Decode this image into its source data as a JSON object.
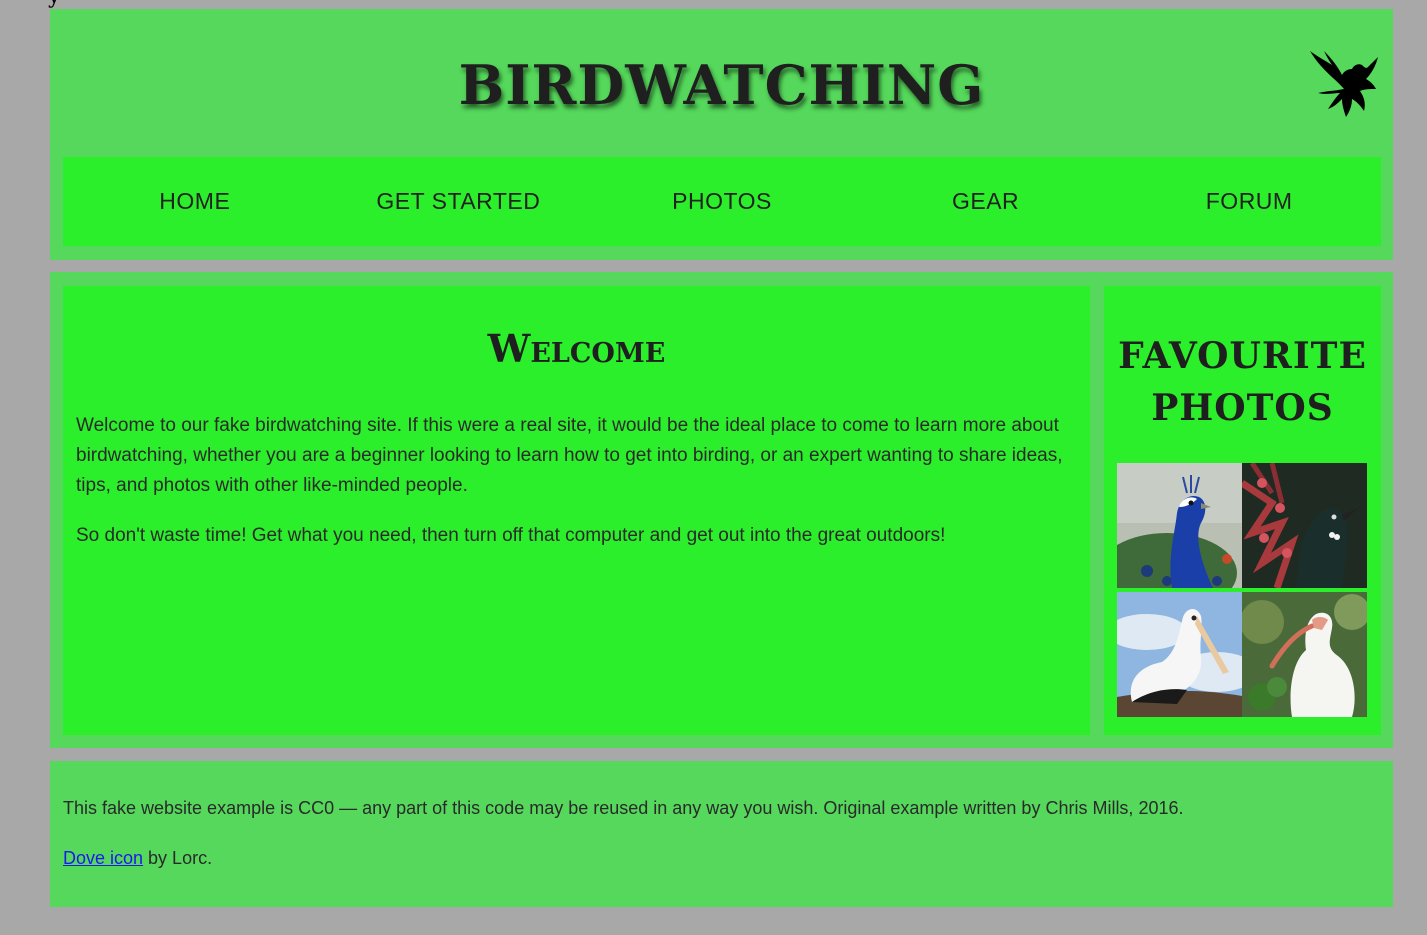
{
  "header": {
    "site_title": "BIRDWATCHING",
    "logo_icon": "dove-icon"
  },
  "nav": {
    "items": [
      {
        "label": "HOME"
      },
      {
        "label": "GET STARTED"
      },
      {
        "label": "PHOTOS"
      },
      {
        "label": "GEAR"
      },
      {
        "label": "FORUM"
      }
    ]
  },
  "article": {
    "heading": "Welcome",
    "paragraphs": [
      "Welcome to our fake birdwatching site. If this were a real site, it would be the ideal place to come to learn more about birdwatching, whether you are a beginner looking to learn how to get into birding, or an expert wanting to share ideas, tips, and photos with other like-minded people.",
      "So don't waste time! Get what you need, then turn off that computer and get out into the great outdoors!"
    ]
  },
  "aside": {
    "heading": "FAVOURITE PHOTOS",
    "photos": [
      "peacock-photo",
      "tui-photo",
      "pelican-photo",
      "ibis-photo"
    ]
  },
  "footer": {
    "license_text": "This fake website example is CC0 — any part of this code may be reused in any way you wish. Original example written by Chris Mills, 2016.",
    "icon_link_label": "Dove icon",
    "icon_credit_suffix": " by Lorc."
  },
  "colors": {
    "page_bg": "#a8a8a8",
    "section_bg": "#55d85b",
    "panel_bg": "#2bef2b",
    "link": "#1a1aee"
  }
}
